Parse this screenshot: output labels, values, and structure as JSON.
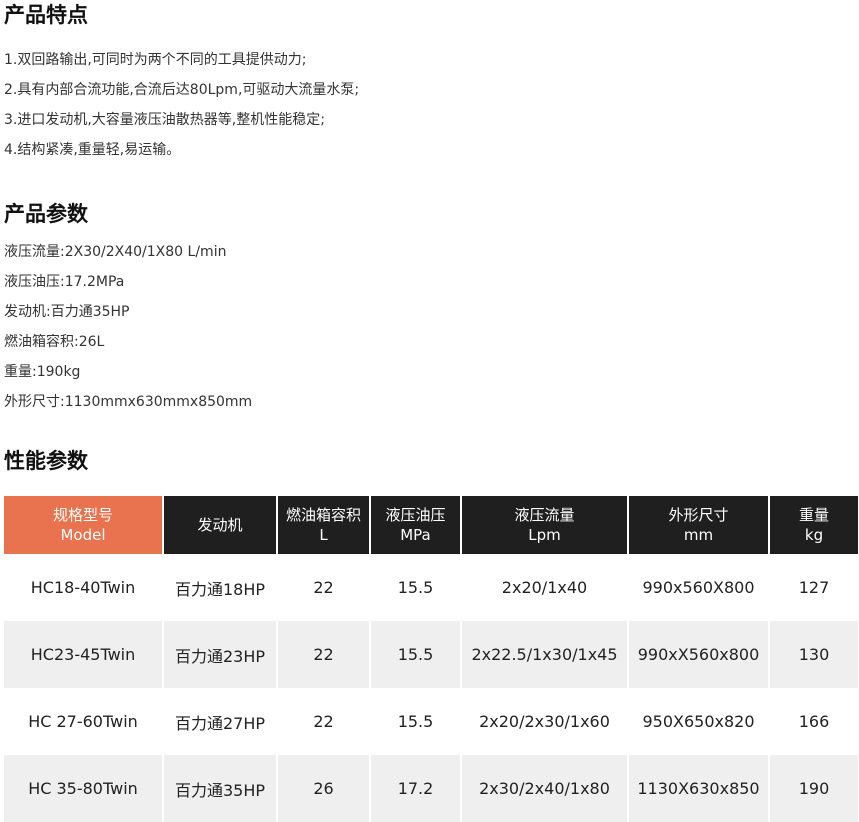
{
  "features": {
    "title": "产品特点",
    "items": [
      "1.双回路输出,可同时为两个不同的工具提供动力;",
      "2.具有内部合流功能,合流后达80Lpm,可驱动大流量水泵;",
      "3.进口发动机,大容量液压油散热器等,整机性能稳定;",
      "4.结构紧凑,重量轻,易运输。"
    ]
  },
  "params": {
    "title": "产品参数",
    "items": [
      "液压流量:2X30/2X40/1X80 L/min",
      "液压油压:17.2MPa",
      "发动机:百力通35HP",
      "燃油箱容积:26L",
      "重量:190kg",
      "外形尺寸:1130mmx630mmx850mm"
    ]
  },
  "performance": {
    "title": "性能参数",
    "header_color": "#1f1f1f",
    "model_header_color": "#e8734e",
    "columns": [
      {
        "line1": "规格型号",
        "line2": "Model"
      },
      {
        "line1": "发动机",
        "line2": ""
      },
      {
        "line1": "燃油箱容积",
        "line2": "L"
      },
      {
        "line1": "液压油压",
        "line2": "MPa"
      },
      {
        "line1": "液压流量",
        "line2": "Lpm"
      },
      {
        "line1": "外形尺寸",
        "line2": "mm"
      },
      {
        "line1": "重量",
        "line2": "kg"
      }
    ],
    "rows": [
      [
        "HC18-40Twin",
        "百力通18HP",
        "22",
        "15.5",
        "2x20/1x40",
        "990x560X800",
        "127"
      ],
      [
        "HC23-45Twin",
        "百力通23HP",
        "22",
        "15.5",
        "2x22.5/1x30/1x45",
        "990xX560x800",
        "130"
      ],
      [
        "HC 27-60Twin",
        "百力通27HP",
        "22",
        "15.5",
        "2x20/2x30/1x60",
        "950X650x820",
        "166"
      ],
      [
        "HC 35-80Twin",
        "百力通35HP",
        "26",
        "17.2",
        "2x30/2x40/1x80",
        "1130X630x850",
        "190"
      ]
    ]
  }
}
